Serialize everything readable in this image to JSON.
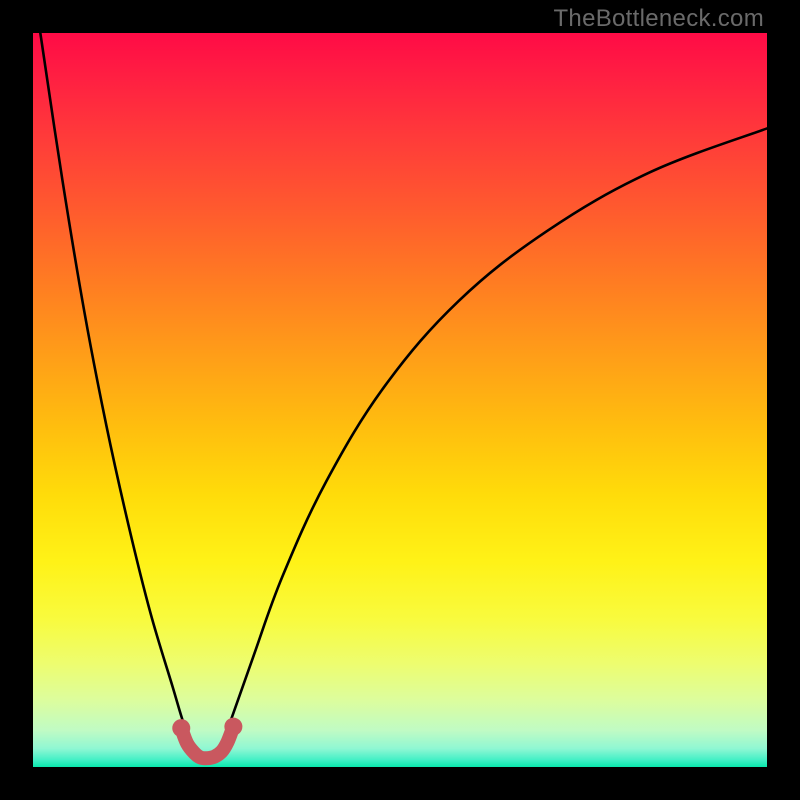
{
  "watermark": {
    "text": "TheBottleneck.com"
  },
  "chart_data": {
    "type": "line",
    "title": "",
    "xlabel": "",
    "ylabel": "",
    "xlim": [
      0,
      100
    ],
    "ylim": [
      0,
      100
    ],
    "grid": false,
    "series": [
      {
        "name": "left-branch",
        "x": [
          1,
          4,
          7,
          10,
          13,
          16,
          19,
          20.5,
          22
        ],
        "y": [
          100,
          80,
          62,
          46.5,
          33,
          21,
          11,
          6,
          2
        ]
      },
      {
        "name": "right-branch",
        "x": [
          25.5,
          27,
          30,
          34,
          40,
          48,
          58,
          70,
          84,
          100
        ],
        "y": [
          2,
          6.5,
          15,
          26,
          39,
          52,
          63.5,
          73,
          81,
          87
        ]
      },
      {
        "name": "optimum-marker",
        "x": [
          20.2,
          21,
          22,
          22.8,
          23.7,
          24.7,
          25.7,
          26.5,
          27.3
        ],
        "y": [
          5.3,
          3.2,
          1.9,
          1.3,
          1.2,
          1.4,
          2.1,
          3.4,
          5.5
        ]
      }
    ],
    "optimum_x_range": [
      20,
      27
    ],
    "colors": {
      "curve": "#000000",
      "marker": "#c9585f",
      "gradient_top": "#ff0b46",
      "gradient_bottom": "#09e8ac"
    }
  }
}
